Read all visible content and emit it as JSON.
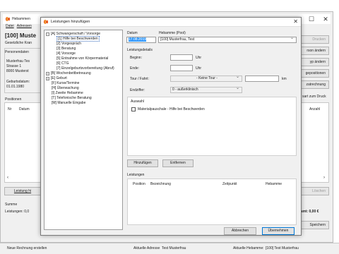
{
  "main_window": {
    "title": "Hebammen",
    "menu": [
      "Datei",
      "Adressen"
    ],
    "header_name": "[100] Muste",
    "header_sub": "Gesetzliche Kran",
    "personendaten_label": "Personendaten",
    "address_lines": [
      "Musterfrau Tes",
      "Strasse 1",
      "8000 Musterst"
    ],
    "geburtsdatum_label": "Geburtsdatum:",
    "geburtsdatum_value": "01.01.1980",
    "positionen_label": "Positionen",
    "col_nr": "Nr",
    "col_datum": "Datum",
    "col_anzahl": "Anzahl",
    "right_buttons": [
      "Drucken",
      "rson ändern",
      "yp ändern",
      "gepositionen",
      "zatrechnung"
    ],
    "druck_note": "sart zum Druck",
    "leistung_button": "Leistung hi",
    "loeschen_button": "Löschen",
    "summe_label": "Summe",
    "leistungen_label": "Leistungen: 0,0",
    "gesamt_label": "esamt: 0,00 €",
    "speichern_button": "Speichern"
  },
  "dialog": {
    "title": "Leistungen hinzufügen",
    "tree": [
      {
        "label": "[A] Schwangerschaft / Vorsorge",
        "level": 0,
        "toggle": "-"
      },
      {
        "label": "[1] Hilfe bei Beschwerden",
        "level": 1,
        "selected": true
      },
      {
        "label": "[2] Vorgespräch",
        "level": 1
      },
      {
        "label": "[3] Beratung",
        "level": 1
      },
      {
        "label": "[4] Vorsorge",
        "level": 1
      },
      {
        "label": "[5] Entnahme von Körpermaterial",
        "level": 1
      },
      {
        "label": "[6] CTG",
        "level": 1
      },
      {
        "label": "[7] Einzelgeburtsvorbereitung (Abruf)",
        "level": 1
      },
      {
        "label": "[B] Wochenbettbetreuung",
        "level": 0,
        "toggle": "+"
      },
      {
        "label": "[E] Geburt",
        "level": 0,
        "toggle": "+"
      },
      {
        "label": "[F] Kurse/Termine",
        "level": 0
      },
      {
        "label": "[H] Überwachung",
        "level": 0
      },
      {
        "label": "[I] Zweite Hebamme",
        "level": 0
      },
      {
        "label": "[T] Telefonische Beratung",
        "level": 0
      },
      {
        "label": "[M] Manuelle Eingabe",
        "level": 0
      }
    ],
    "datum_label": "Datum",
    "datum_value": "17.08.2019",
    "hebamme_label": "Hebamme (Pool)",
    "hebamme_value": "[100] Musterfrau, Test",
    "leistungsdetails_label": "Leistungsdetails",
    "beginn_label": "Beginn:",
    "ende_label": "Ende:",
    "uhr_label": "Uhr",
    "tour_label": "Tour / Fahrt:",
    "tour_value": "- Keine Tour -",
    "km_label": "km",
    "endziffer_label": "Endziffer:",
    "endziffer_value": "0 - außerklinisch",
    "auswahl_label": "Auswahl",
    "material_checkbox_label": "Materialpauschale - Hilfe bei Beschwerden",
    "hinzufuegen_button": "Hinzufügen",
    "entfernen_button": "Entfernen",
    "leistungen_label": "Leistungen",
    "table_headers": [
      "Position",
      "Bezeichnung",
      "Zeitpunkt",
      "Hebamme"
    ],
    "abbrechen_button": "Abbrechen",
    "uebernehmen_button": "Übernehmen"
  },
  "statusbar": {
    "left": "Neue Rechnung erstellen",
    "adresse_label": "Aktuelle Adresse",
    "adresse_value": "Test Musterfrau",
    "hebamme_label": "Aktuelle Hebamme:",
    "hebamme_value": "[100] Test Musterfrau"
  },
  "colors": {
    "selection": "#3399ff",
    "default_button_border": "#0078d7",
    "app_icon": "#e8612c"
  }
}
